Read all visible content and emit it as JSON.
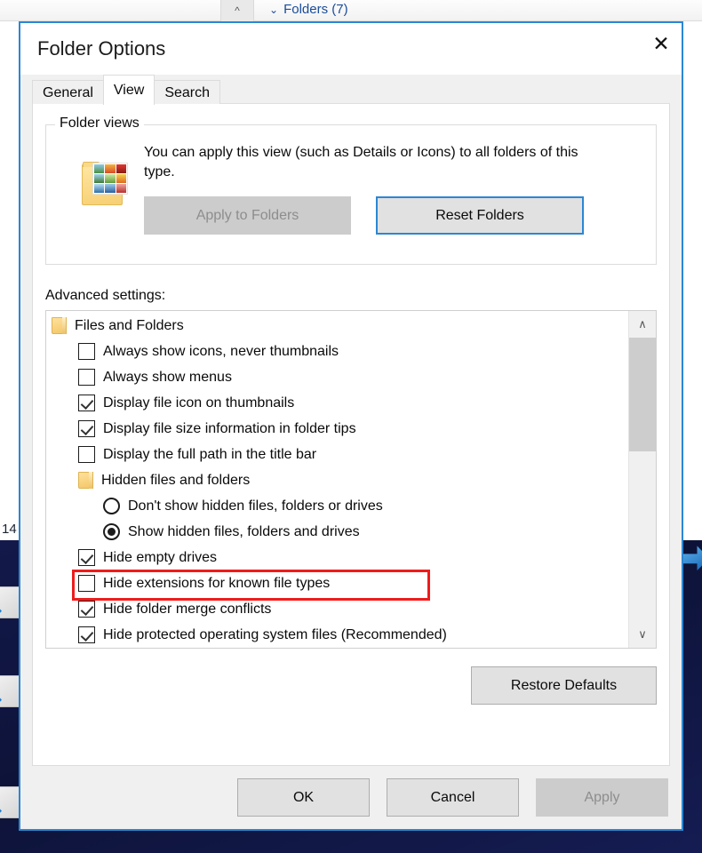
{
  "background": {
    "collapse_icon": "chevron-up-icon",
    "folders_group_label": "Folders (7)",
    "folders_chevron": "⌄",
    "clipped_text": "14"
  },
  "dialog": {
    "title": "Folder Options",
    "close_icon": "✕",
    "accent_color": "#2b87d4"
  },
  "tabs": [
    {
      "label": "General",
      "active": false
    },
    {
      "label": "View",
      "active": true
    },
    {
      "label": "Search",
      "active": false
    }
  ],
  "folder_views": {
    "legend": "Folder views",
    "description": "You can apply this view (such as Details or Icons) to all folders of this type.",
    "icon_name": "folder-with-thumbnails-icon",
    "apply_to_folders": {
      "label": "Apply to Folders",
      "disabled": true
    },
    "reset_folders": {
      "label": "Reset Folders",
      "focused": true
    }
  },
  "advanced": {
    "label": "Advanced settings:",
    "items": [
      {
        "type": "header",
        "indent": 1,
        "label": "Files and Folders"
      },
      {
        "type": "checkbox",
        "indent": 2,
        "label": "Always show icons, never thumbnails",
        "checked": false
      },
      {
        "type": "checkbox",
        "indent": 2,
        "label": "Always show menus",
        "checked": false
      },
      {
        "type": "checkbox",
        "indent": 2,
        "label": "Display file icon on thumbnails",
        "checked": true
      },
      {
        "type": "checkbox",
        "indent": 2,
        "label": "Display file size information in folder tips",
        "checked": true
      },
      {
        "type": "checkbox",
        "indent": 2,
        "label": "Display the full path in the title bar",
        "checked": false
      },
      {
        "type": "header",
        "indent": 2,
        "label": "Hidden files and folders"
      },
      {
        "type": "radio",
        "indent": 3,
        "label": "Don't show hidden files, folders or drives",
        "checked": false
      },
      {
        "type": "radio",
        "indent": 3,
        "label": "Show hidden files, folders and drives",
        "checked": true
      },
      {
        "type": "checkbox",
        "indent": 2,
        "label": "Hide empty drives",
        "checked": true
      },
      {
        "type": "checkbox",
        "indent": 2,
        "label": "Hide extensions for known file types",
        "checked": false,
        "highlighted": true
      },
      {
        "type": "checkbox",
        "indent": 2,
        "label": "Hide folder merge conflicts",
        "checked": true
      },
      {
        "type": "checkbox",
        "indent": 2,
        "label": "Hide protected operating system files (Recommended)",
        "checked": true
      },
      {
        "type": "checkbox",
        "indent": 2,
        "label": "",
        "checked": false
      }
    ],
    "scrollbar": {
      "up_arrow": "∧",
      "down_arrow": "∨",
      "thumb_position": "top"
    },
    "highlight_color": "#ef1c1c"
  },
  "restore_defaults": {
    "label": "Restore Defaults"
  },
  "footer": {
    "ok": {
      "label": "OK",
      "disabled": false
    },
    "cancel": {
      "label": "Cancel",
      "disabled": false
    },
    "apply": {
      "label": "Apply",
      "disabled": true
    }
  }
}
